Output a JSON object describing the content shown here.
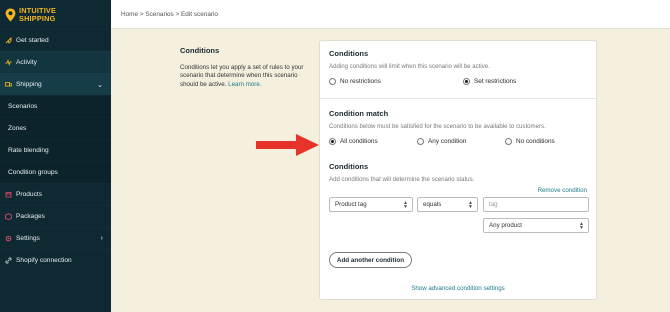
{
  "brand": {
    "line1": "INTUITIVE",
    "line2": "SHIPPING",
    "accent": "#f3b71b"
  },
  "sidebar": {
    "items": [
      {
        "label": "Get started",
        "icon": "rocket-icon"
      },
      {
        "label": "Activity",
        "icon": "activity-icon"
      },
      {
        "label": "Shipping",
        "icon": "truck-icon"
      },
      {
        "label": "Scenarios"
      },
      {
        "label": "Zones"
      },
      {
        "label": "Rate blending"
      },
      {
        "label": "Condition groups"
      },
      {
        "label": "Products",
        "icon": "box-icon"
      },
      {
        "label": "Packages",
        "icon": "package-icon"
      },
      {
        "label": "Settings",
        "icon": "gear-icon"
      },
      {
        "label": "Shopify connection",
        "icon": "link-icon"
      }
    ]
  },
  "breadcrumb": "Home > Scenarios > Edit scenario",
  "intro": {
    "title": "Conditions",
    "text": "Conditions let you apply a set of rules to your scenario that determine when this scenario should be active.",
    "link": "Learn more."
  },
  "card": {
    "conditions": {
      "title": "Conditions",
      "description": "Adding conditions will limit when this scenario will be active.",
      "options": [
        "No restrictions",
        "Set restrictions"
      ],
      "selected": "Set restrictions"
    },
    "match": {
      "title": "Condition match",
      "description": "Conditions below must be satisfied for the scenario to be available to customers.",
      "options": [
        "All conditions",
        "Any condition",
        "No conditions"
      ],
      "selected": "All conditions"
    },
    "rules": {
      "title": "Conditions",
      "description": "Add conditions that will determine the scenario status.",
      "remove_label": "Remove condition",
      "field_value": "Product tag",
      "operator_value": "equals",
      "tag_placeholder": "tag",
      "scope_value": "Any product",
      "add_button": "Add another condition",
      "advanced_link": "Show advanced condition settings"
    }
  }
}
